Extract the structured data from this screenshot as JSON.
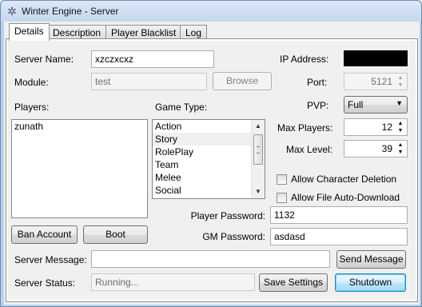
{
  "window": {
    "title": "Winter Engine - Server",
    "icon": "snowflake-icon"
  },
  "tabs": [
    {
      "label": "Details",
      "active": true
    },
    {
      "label": "Description",
      "active": false
    },
    {
      "label": "Player Blacklist",
      "active": false
    },
    {
      "label": "Log",
      "active": false
    }
  ],
  "details": {
    "server_name": {
      "label": "Server Name:",
      "value": "xzczxcxz"
    },
    "ip_address": {
      "label": "IP Address:",
      "value": ""
    },
    "module": {
      "label": "Module:",
      "value": "test",
      "browse_label": "Browse"
    },
    "port": {
      "label": "Port:",
      "value": "5121"
    },
    "players": {
      "label": "Players:",
      "items": [
        "zunath"
      ]
    },
    "game_type": {
      "label": "Game Type:",
      "options": [
        "Action",
        "Story",
        "RolePlay",
        "Team",
        "Melee",
        "Social"
      ],
      "selected": "Story"
    },
    "pvp": {
      "label": "PVP:",
      "value": "Full"
    },
    "max_players": {
      "label": "Max Players:",
      "value": "12"
    },
    "max_level": {
      "label": "Max Level:",
      "value": "39"
    },
    "allow_character_deletion": {
      "label": "Allow Character Deletion",
      "checked": false
    },
    "allow_file_auto_download": {
      "label": "Allow File Auto-Download",
      "checked": false
    },
    "ban_account_label": "Ban Account",
    "boot_label": "Boot",
    "player_password": {
      "label": "Player Password:",
      "value": "1132"
    },
    "gm_password": {
      "label": "GM Password:",
      "value": "asdasd"
    },
    "server_message": {
      "label": "Server Message:",
      "value": "",
      "send_label": "Send Message"
    },
    "server_status": {
      "label": "Server Status:",
      "value": "Running..."
    },
    "save_settings_label": "Save Settings",
    "shutdown_label": "Shutdown"
  }
}
